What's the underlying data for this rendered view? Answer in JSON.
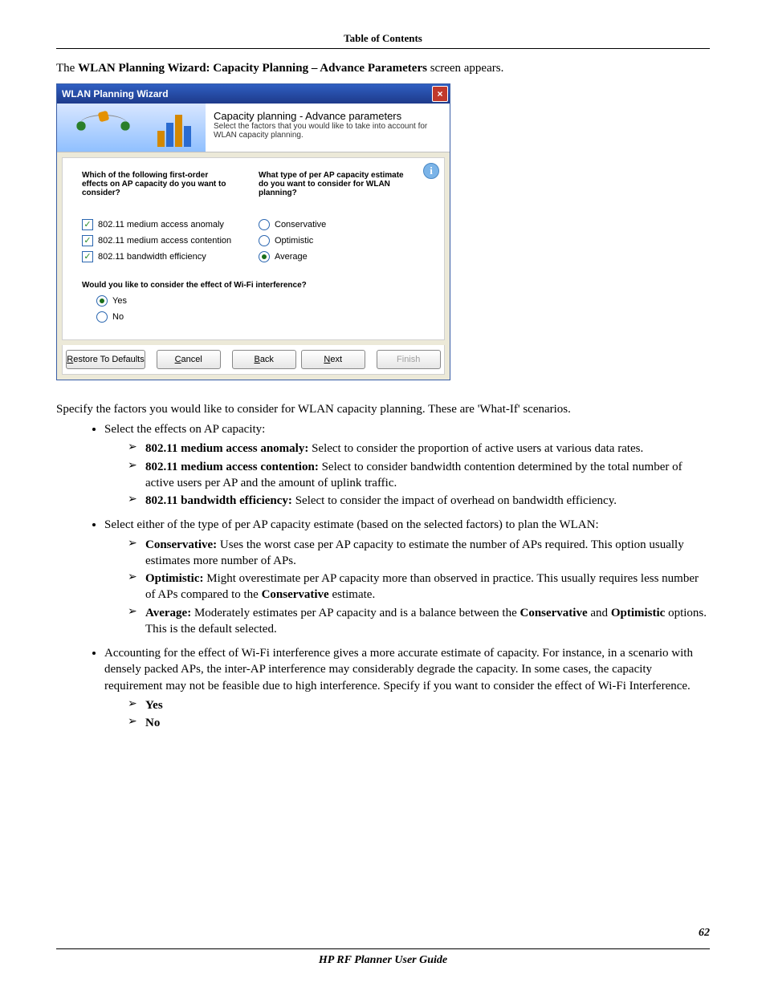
{
  "header": {
    "toc": "Table of Contents"
  },
  "intro": {
    "pre": "The ",
    "bold": "WLAN Planning Wizard: Capacity Planning – Advance Parameters",
    "post": " screen appears."
  },
  "wizard": {
    "title": "WLAN Planning Wizard",
    "header_title": "Capacity planning - Advance parameters",
    "header_sub": "Select the factors that you would like to take into account for WLAN capacity planning.",
    "q1": "Which of the following first-order effects on AP capacity do you want to consider?",
    "q2": "What type of per AP capacity estimate do you want to consider for WLAN planning?",
    "effects": [
      {
        "label": "802.11 medium access anomaly",
        "checked": true
      },
      {
        "label": "802.11 medium access contention",
        "checked": true
      },
      {
        "label": "802.11 bandwidth efficiency",
        "checked": true
      }
    ],
    "estimates": [
      {
        "label": "Conservative",
        "checked": false
      },
      {
        "label": "Optimistic",
        "checked": false
      },
      {
        "label": "Average",
        "checked": true
      }
    ],
    "wifi_q": "Would you like to consider the effect of Wi-Fi interference?",
    "wifi_yes": "Yes",
    "wifi_no": "No",
    "buttons": {
      "restore": "Restore To Defaults",
      "cancel": "Cancel",
      "back": "Back",
      "next": "Next",
      "finish": "Finish"
    }
  },
  "body": {
    "specify": "Specify the factors you would like to consider for WLAN capacity planning. These are 'What-If' scenarios.",
    "select_effects": "Select the effects on AP capacity:",
    "eff_items": [
      {
        "bold": "802.11 medium access anomaly:",
        "rest": " Select to consider the proportion of active users at various data rates."
      },
      {
        "bold": "802.11 medium access contention:",
        "rest": " Select to consider bandwidth contention determined by the total number of active users per AP and the amount of uplink traffic."
      },
      {
        "bold": "802.11 bandwidth efficiency:",
        "rest": " Select to consider the impact of overhead on bandwidth efficiency."
      }
    ],
    "select_type": "Select either of the type of per AP capacity estimate (based on the selected factors) to plan the WLAN:",
    "type_items": {
      "cons": {
        "bold": "Conservative:",
        "rest": " Uses the worst case per AP capacity to estimate the number of APs required. This option usually estimates more number of APs."
      },
      "opt": {
        "bold": "Optimistic:",
        "rest_a": " Might overestimate per AP capacity more than observed in practice. This usually requires less number of APs compared to the ",
        "rest_bold": "Conservative",
        "rest_b": " estimate."
      },
      "avg": {
        "bold": "Average:",
        "rest_a": " Moderately estimates per AP capacity and is a balance between the ",
        "rest_bold1": "Conservative",
        "rest_mid": " and ",
        "rest_bold2": "Optimistic",
        "rest_b": " options. This is the default selected."
      }
    },
    "wifi_para": "Accounting for the effect of Wi-Fi interference gives a more accurate estimate of capacity. For instance, in a scenario with densely packed APs, the inter-AP interference may considerably degrade the capacity. In some cases, the capacity requirement may not be feasible due to high interference. Specify if you want to consider the effect of Wi-Fi Interference.",
    "wifi_opts": {
      "yes": "Yes",
      "no": "No"
    }
  },
  "footer": {
    "page": "62",
    "guide": "HP RF Planner User Guide"
  }
}
